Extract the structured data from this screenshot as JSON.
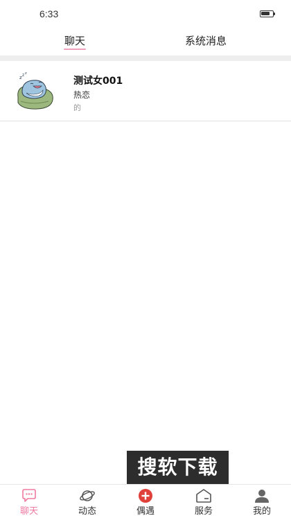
{
  "status_bar": {
    "time": "6:33",
    "battery_level": 0.8
  },
  "tabs": {
    "items": [
      {
        "label": "聊天",
        "active": true
      },
      {
        "label": "系统消息",
        "active": false
      }
    ]
  },
  "conversations": [
    {
      "name": "测试女001",
      "status": "热恋",
      "preview": "的",
      "avatar": "sleeping-shark-sticker"
    }
  ],
  "watermark": {
    "text": "搜软下载"
  },
  "bottom_nav": {
    "items": [
      {
        "label": "聊天",
        "icon": "chat-bubble-icon",
        "active": true
      },
      {
        "label": "动态",
        "icon": "planet-icon",
        "active": false
      },
      {
        "label": "偶遇",
        "icon": "plus-circle-icon",
        "active": false
      },
      {
        "label": "服务",
        "icon": "service-box-icon",
        "active": false
      },
      {
        "label": "我的",
        "icon": "user-icon",
        "active": false
      }
    ]
  },
  "colors": {
    "accent": "#f07aa0",
    "plus_red": "#e0403a",
    "divider": "#eeeeee"
  }
}
